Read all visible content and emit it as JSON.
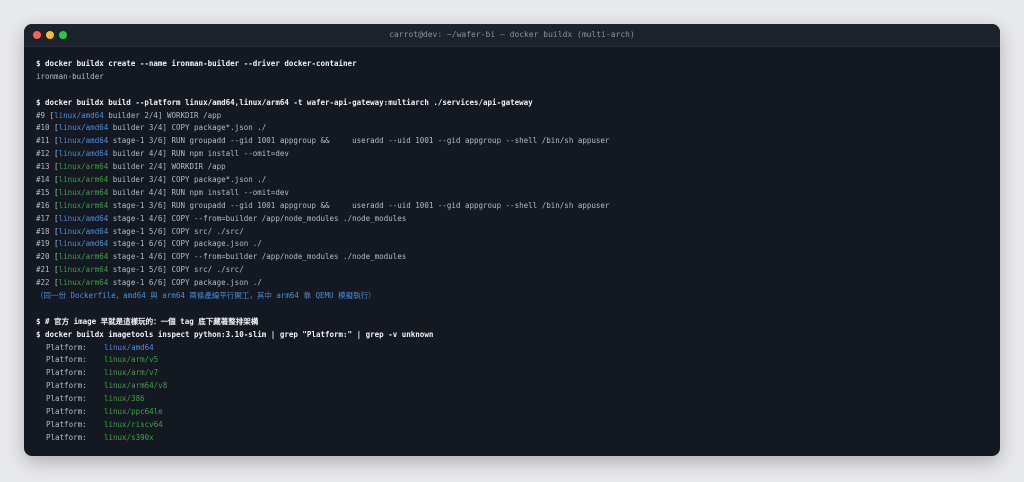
{
  "window": {
    "title": "carrot@dev: ~/wafer-bi — docker buildx (multi-arch)"
  },
  "colors": {
    "amd64": "#4c8ed8",
    "arm64": "#3fa04a",
    "background": "#141820"
  },
  "terminal": {
    "cmd1": "$ docker buildx create --name ironman-builder --driver docker-container",
    "out1": "ironman-builder",
    "cmd2": "$ docker buildx build --platform linux/amd64,linux/arm64 -t wafer-api-gateway:multiarch ./services/api-gateway",
    "build_lines": [
      {
        "pre": "#9 [",
        "arch": "linux/amd64",
        "post": " builder 2/4] WORKDIR /app"
      },
      {
        "pre": "#10 [",
        "arch": "linux/amd64",
        "post": " builder 3/4] COPY package*.json ./"
      },
      {
        "pre": "#11 [",
        "arch": "linux/amd64",
        "post": " stage-1 3/6] RUN groupadd --gid 1001 appgroup &&     useradd --uid 1001 --gid appgroup --shell /bin/sh appuser"
      },
      {
        "pre": "#12 [",
        "arch": "linux/amd64",
        "post": " builder 4/4] RUN npm install --omit=dev"
      },
      {
        "pre": "#13 [",
        "arch": "linux/arm64",
        "post": " builder 2/4] WORKDIR /app"
      },
      {
        "pre": "#14 [",
        "arch": "linux/arm64",
        "post": " builder 3/4] COPY package*.json ./"
      },
      {
        "pre": "#15 [",
        "arch": "linux/arm64",
        "post": " builder 4/4] RUN npm install --omit=dev"
      },
      {
        "pre": "#16 [",
        "arch": "linux/arm64",
        "post": " stage-1 3/6] RUN groupadd --gid 1001 appgroup &&     useradd --uid 1001 --gid appgroup --shell /bin/sh appuser"
      },
      {
        "pre": "#17 [",
        "arch": "linux/amd64",
        "post": " stage-1 4/6] COPY --from=builder /app/node_modules ./node_modules"
      },
      {
        "pre": "#18 [",
        "arch": "linux/amd64",
        "post": " stage-1 5/6] COPY src/ ./src/"
      },
      {
        "pre": "#19 [",
        "arch": "linux/amd64",
        "post": " stage-1 6/6] COPY package.json ./"
      },
      {
        "pre": "#20 [",
        "arch": "linux/arm64",
        "post": " stage-1 4/6] COPY --from=builder /app/node_modules ./node_modules"
      },
      {
        "pre": "#21 [",
        "arch": "linux/arm64",
        "post": " stage-1 5/6] COPY src/ ./src/"
      },
      {
        "pre": "#22 [",
        "arch": "linux/arm64",
        "post": " stage-1 6/6] COPY package.json ./"
      }
    ],
    "note": "（同一份 Dockerfile，amd64 與 arm64 兩條產線平行開工，其中 arm64 靠 QEMU 模擬執行）",
    "cmd3": "$ # 官方 image 早就是這樣玩的：一個 tag 底下藏著整排架構",
    "cmd4": "$ docker buildx imagetools inspect python:3.10-slim | grep \"Platform:\" | grep -v unknown",
    "platforms": [
      {
        "key": "Platform:",
        "value": "linux/amd64"
      },
      {
        "key": "Platform:",
        "value": "linux/arm/v5"
      },
      {
        "key": "Platform:",
        "value": "linux/arm/v7"
      },
      {
        "key": "Platform:",
        "value": "linux/arm64/v8"
      },
      {
        "key": "Platform:",
        "value": "linux/386"
      },
      {
        "key": "Platform:",
        "value": "linux/ppc64le"
      },
      {
        "key": "Platform:",
        "value": "linux/riscv64"
      },
      {
        "key": "Platform:",
        "value": "linux/s390x"
      }
    ]
  }
}
